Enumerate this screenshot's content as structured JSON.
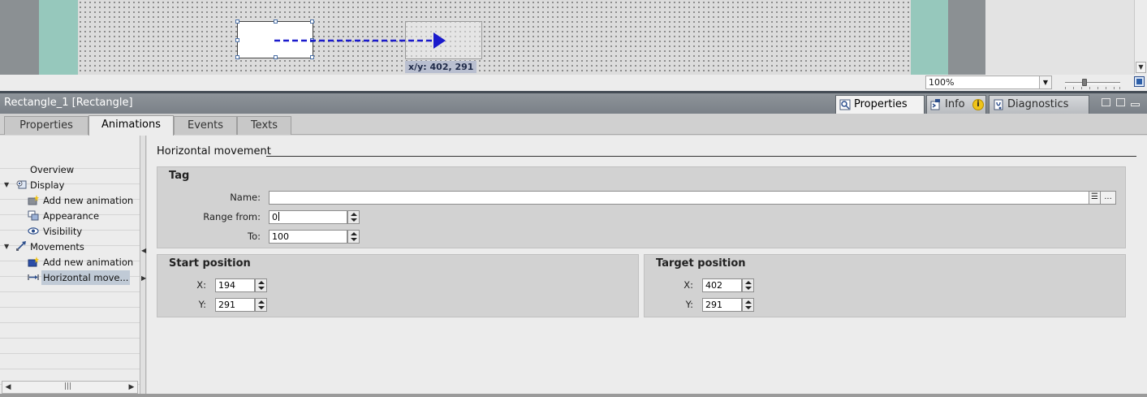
{
  "canvas": {
    "coord_label": "x/y: 402, 291",
    "zoom": {
      "value": "100%",
      "options_collapsed": true
    }
  },
  "inspector": {
    "object_title": "Rectangle_1 [Rectangle]",
    "tabs": [
      {
        "label": "Properties",
        "icon": "properties-icon",
        "active": true
      },
      {
        "label": "Info",
        "icon": "info-icon",
        "badge": "i"
      },
      {
        "label": "Diagnostics",
        "icon": "diagnostics-icon"
      }
    ]
  },
  "subtabs": [
    {
      "label": "Properties"
    },
    {
      "label": "Animations",
      "active": true
    },
    {
      "label": "Events"
    },
    {
      "label": "Texts"
    }
  ],
  "nav": {
    "items": [
      {
        "label": "Overview",
        "level": 0
      },
      {
        "label": "Display",
        "level": 0,
        "expanded": true,
        "icon": "display-icon"
      },
      {
        "label": "Add new animation",
        "level": 1,
        "icon": "add-animation-icon"
      },
      {
        "label": "Appearance",
        "level": 1,
        "icon": "appearance-icon"
      },
      {
        "label": "Visibility",
        "level": 1,
        "icon": "visibility-icon"
      },
      {
        "label": "Movements",
        "level": 0,
        "expanded": true,
        "icon": "movements-icon"
      },
      {
        "label": "Add new animation",
        "level": 1,
        "icon": "add-animation-icon"
      },
      {
        "label": "Horizontal move...",
        "level": 1,
        "icon": "horizontal-movement-icon",
        "selected": true
      }
    ]
  },
  "content": {
    "section_title": "Horizontal movement",
    "tag": {
      "title": "Tag",
      "name_label": "Name:",
      "name_value": "",
      "range_from_label": "Range from:",
      "range_from_value": "0",
      "to_label": "To:",
      "to_value": "100",
      "browse_label": "..."
    },
    "start_position": {
      "title": "Start position",
      "x_label": "X:",
      "x_value": "194",
      "y_label": "Y:",
      "y_value": "291"
    },
    "target_position": {
      "title": "Target position",
      "x_label": "X:",
      "x_value": "402",
      "y_label": "Y:",
      "y_value": "291"
    }
  },
  "colors": {
    "accent_arrow": "#1a1acc",
    "teal_strip": "#96c8bc",
    "header_bg": "#80868c",
    "selection": "#c0cad6"
  }
}
